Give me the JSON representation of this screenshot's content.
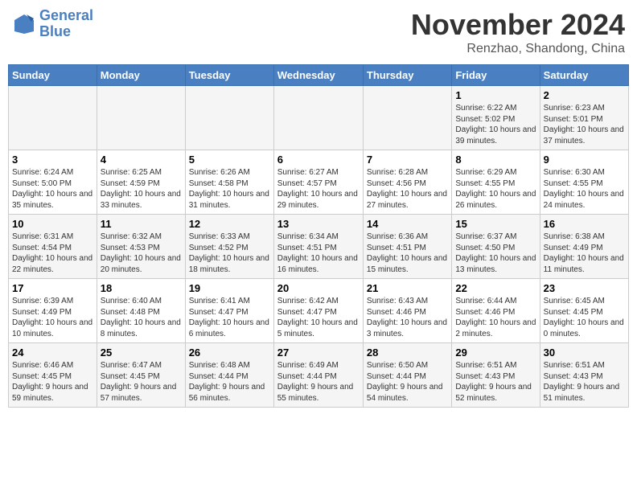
{
  "header": {
    "logo_line1": "General",
    "logo_line2": "Blue",
    "month_title": "November 2024",
    "location": "Renzhao, Shandong, China"
  },
  "days_of_week": [
    "Sunday",
    "Monday",
    "Tuesday",
    "Wednesday",
    "Thursday",
    "Friday",
    "Saturday"
  ],
  "weeks": [
    [
      {
        "day": "",
        "info": ""
      },
      {
        "day": "",
        "info": ""
      },
      {
        "day": "",
        "info": ""
      },
      {
        "day": "",
        "info": ""
      },
      {
        "day": "",
        "info": ""
      },
      {
        "day": "1",
        "info": "Sunrise: 6:22 AM\nSunset: 5:02 PM\nDaylight: 10 hours and 39 minutes."
      },
      {
        "day": "2",
        "info": "Sunrise: 6:23 AM\nSunset: 5:01 PM\nDaylight: 10 hours and 37 minutes."
      }
    ],
    [
      {
        "day": "3",
        "info": "Sunrise: 6:24 AM\nSunset: 5:00 PM\nDaylight: 10 hours and 35 minutes."
      },
      {
        "day": "4",
        "info": "Sunrise: 6:25 AM\nSunset: 4:59 PM\nDaylight: 10 hours and 33 minutes."
      },
      {
        "day": "5",
        "info": "Sunrise: 6:26 AM\nSunset: 4:58 PM\nDaylight: 10 hours and 31 minutes."
      },
      {
        "day": "6",
        "info": "Sunrise: 6:27 AM\nSunset: 4:57 PM\nDaylight: 10 hours and 29 minutes."
      },
      {
        "day": "7",
        "info": "Sunrise: 6:28 AM\nSunset: 4:56 PM\nDaylight: 10 hours and 27 minutes."
      },
      {
        "day": "8",
        "info": "Sunrise: 6:29 AM\nSunset: 4:55 PM\nDaylight: 10 hours and 26 minutes."
      },
      {
        "day": "9",
        "info": "Sunrise: 6:30 AM\nSunset: 4:55 PM\nDaylight: 10 hours and 24 minutes."
      }
    ],
    [
      {
        "day": "10",
        "info": "Sunrise: 6:31 AM\nSunset: 4:54 PM\nDaylight: 10 hours and 22 minutes."
      },
      {
        "day": "11",
        "info": "Sunrise: 6:32 AM\nSunset: 4:53 PM\nDaylight: 10 hours and 20 minutes."
      },
      {
        "day": "12",
        "info": "Sunrise: 6:33 AM\nSunset: 4:52 PM\nDaylight: 10 hours and 18 minutes."
      },
      {
        "day": "13",
        "info": "Sunrise: 6:34 AM\nSunset: 4:51 PM\nDaylight: 10 hours and 16 minutes."
      },
      {
        "day": "14",
        "info": "Sunrise: 6:36 AM\nSunset: 4:51 PM\nDaylight: 10 hours and 15 minutes."
      },
      {
        "day": "15",
        "info": "Sunrise: 6:37 AM\nSunset: 4:50 PM\nDaylight: 10 hours and 13 minutes."
      },
      {
        "day": "16",
        "info": "Sunrise: 6:38 AM\nSunset: 4:49 PM\nDaylight: 10 hours and 11 minutes."
      }
    ],
    [
      {
        "day": "17",
        "info": "Sunrise: 6:39 AM\nSunset: 4:49 PM\nDaylight: 10 hours and 10 minutes."
      },
      {
        "day": "18",
        "info": "Sunrise: 6:40 AM\nSunset: 4:48 PM\nDaylight: 10 hours and 8 minutes."
      },
      {
        "day": "19",
        "info": "Sunrise: 6:41 AM\nSunset: 4:47 PM\nDaylight: 10 hours and 6 minutes."
      },
      {
        "day": "20",
        "info": "Sunrise: 6:42 AM\nSunset: 4:47 PM\nDaylight: 10 hours and 5 minutes."
      },
      {
        "day": "21",
        "info": "Sunrise: 6:43 AM\nSunset: 4:46 PM\nDaylight: 10 hours and 3 minutes."
      },
      {
        "day": "22",
        "info": "Sunrise: 6:44 AM\nSunset: 4:46 PM\nDaylight: 10 hours and 2 minutes."
      },
      {
        "day": "23",
        "info": "Sunrise: 6:45 AM\nSunset: 4:45 PM\nDaylight: 10 hours and 0 minutes."
      }
    ],
    [
      {
        "day": "24",
        "info": "Sunrise: 6:46 AM\nSunset: 4:45 PM\nDaylight: 9 hours and 59 minutes."
      },
      {
        "day": "25",
        "info": "Sunrise: 6:47 AM\nSunset: 4:45 PM\nDaylight: 9 hours and 57 minutes."
      },
      {
        "day": "26",
        "info": "Sunrise: 6:48 AM\nSunset: 4:44 PM\nDaylight: 9 hours and 56 minutes."
      },
      {
        "day": "27",
        "info": "Sunrise: 6:49 AM\nSunset: 4:44 PM\nDaylight: 9 hours and 55 minutes."
      },
      {
        "day": "28",
        "info": "Sunrise: 6:50 AM\nSunset: 4:44 PM\nDaylight: 9 hours and 54 minutes."
      },
      {
        "day": "29",
        "info": "Sunrise: 6:51 AM\nSunset: 4:43 PM\nDaylight: 9 hours and 52 minutes."
      },
      {
        "day": "30",
        "info": "Sunrise: 6:51 AM\nSunset: 4:43 PM\nDaylight: 9 hours and 51 minutes."
      }
    ]
  ]
}
